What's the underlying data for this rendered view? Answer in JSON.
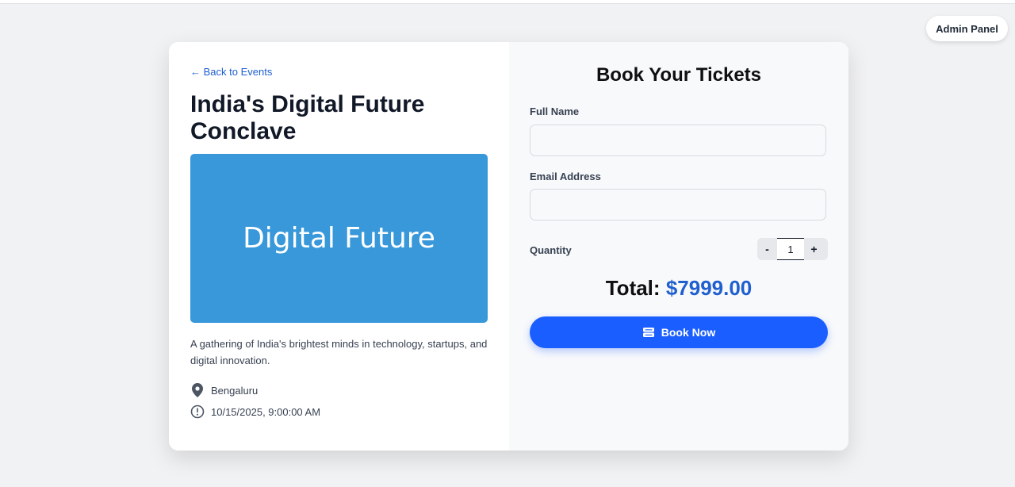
{
  "header": {
    "admin_button_label": "Admin Panel"
  },
  "event": {
    "back_link": "← Back to Events",
    "title": "India's Digital Future Conclave",
    "banner_text": "Digital Future",
    "description": "A gathering of India's brightest minds in technology, startups, and digital innovation.",
    "location": "Bengaluru",
    "location_icon": "map-pin-icon",
    "datetime": "10/15/2025, 9:00:00 AM",
    "datetime_icon": "clock-icon"
  },
  "booking": {
    "title": "Book Your Tickets",
    "full_name_label": "Full Name",
    "full_name_value": "",
    "email_label": "Email Address",
    "email_value": "",
    "quantity_label": "Quantity",
    "decrement_label": "-",
    "quantity_value": "1",
    "increment_label": "+",
    "total_label": "Total:",
    "total_amount": "$7999.00",
    "book_button_label": "Book Now",
    "book_button_icon": "ticket-icon"
  },
  "colors": {
    "accent": "#1b5eff",
    "link": "#1f5fcf",
    "banner": "#3898da"
  }
}
